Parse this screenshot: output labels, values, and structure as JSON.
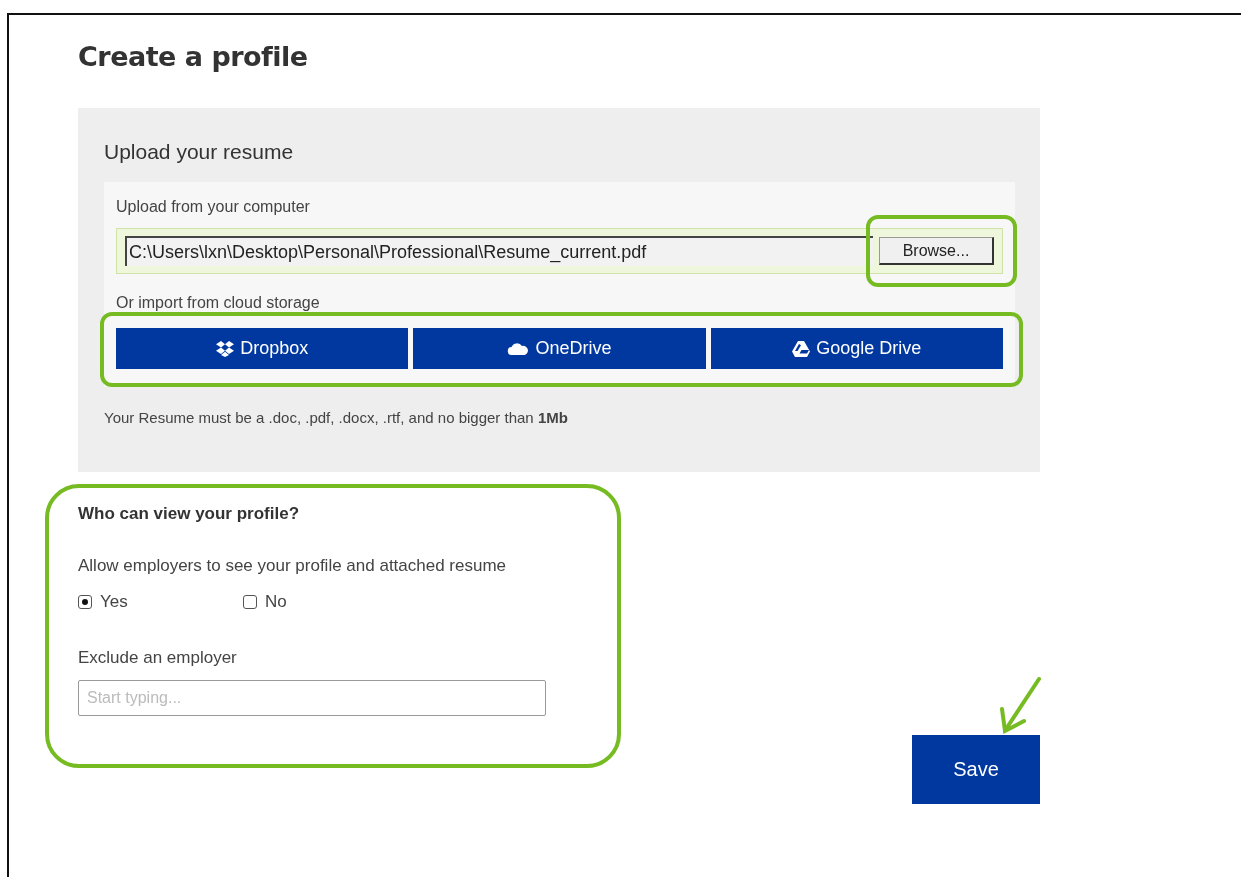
{
  "title": "Create a profile",
  "upload": {
    "heading": "Upload your resume",
    "computer_label": "Upload from your computer",
    "file_value": "C:\\Users\\lxn\\Desktop\\Personal\\Professional\\Resume_current.pdf",
    "browse_button": "Browse...",
    "cloud_label": "Or import from cloud storage",
    "cloud_buttons": [
      {
        "kind": "dropbox",
        "label": "Dropbox"
      },
      {
        "kind": "onedrive",
        "label": "OneDrive"
      },
      {
        "kind": "gdrive",
        "label": "Google Drive"
      }
    ],
    "note": "Your Resume must be a .doc, .pdf, .docx, .rtf, and no bigger than **1Mb**"
  },
  "visibility": {
    "heading": "Who can view your profile?",
    "question": "Allow employers to see your profile and attached resume",
    "options": [
      {
        "label": "Yes",
        "selected": true
      },
      {
        "label": "No",
        "selected": false
      }
    ],
    "exclude_label": "Exclude an employer",
    "exclude_placeholder": "Start typing..."
  },
  "save_button": "Save"
}
